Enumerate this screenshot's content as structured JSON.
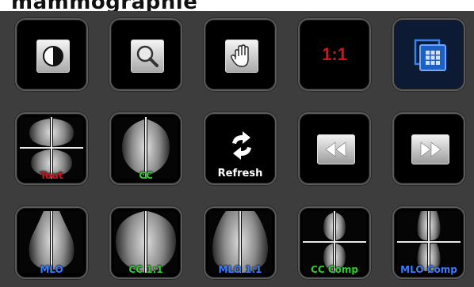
{
  "header": {
    "title": "mammographie"
  },
  "tools": [
    {
      "name": "contrast",
      "icon": "contrast-icon"
    },
    {
      "name": "zoom",
      "icon": "magnifier-icon"
    },
    {
      "name": "pan",
      "icon": "hand-icon"
    },
    {
      "name": "ratio",
      "icon": "ratio-icon",
      "text": "1:1"
    },
    {
      "name": "layout",
      "icon": "grid-layout-icon",
      "selected": true
    }
  ],
  "layouts_row": [
    {
      "label": "Tout",
      "color": "#d4141c"
    },
    {
      "label": "CC",
      "color": "#2bd02b"
    },
    {
      "label": "Refresh",
      "color": "#ffffff"
    },
    {
      "icon": "rewind-icon"
    },
    {
      "icon": "fast-forward-icon"
    }
  ],
  "views_row": [
    {
      "label": "MLO",
      "color": "#3a7cff"
    },
    {
      "label": "CC 1:1",
      "color": "#2bd02b"
    },
    {
      "label": "MLO 1:1",
      "color": "#3a7cff"
    },
    {
      "label": "CC Comp",
      "color": "#2bd02b"
    },
    {
      "label": "MLO Comp",
      "color": "#3a7cff"
    }
  ],
  "colors": {
    "background": "#3d3d3d",
    "tile": "#000000",
    "selected_tile": "#0c1a33",
    "ratio_text": "#d31313",
    "label_red": "#d4141c",
    "label_green": "#2bd02b",
    "label_blue": "#3a7cff"
  }
}
